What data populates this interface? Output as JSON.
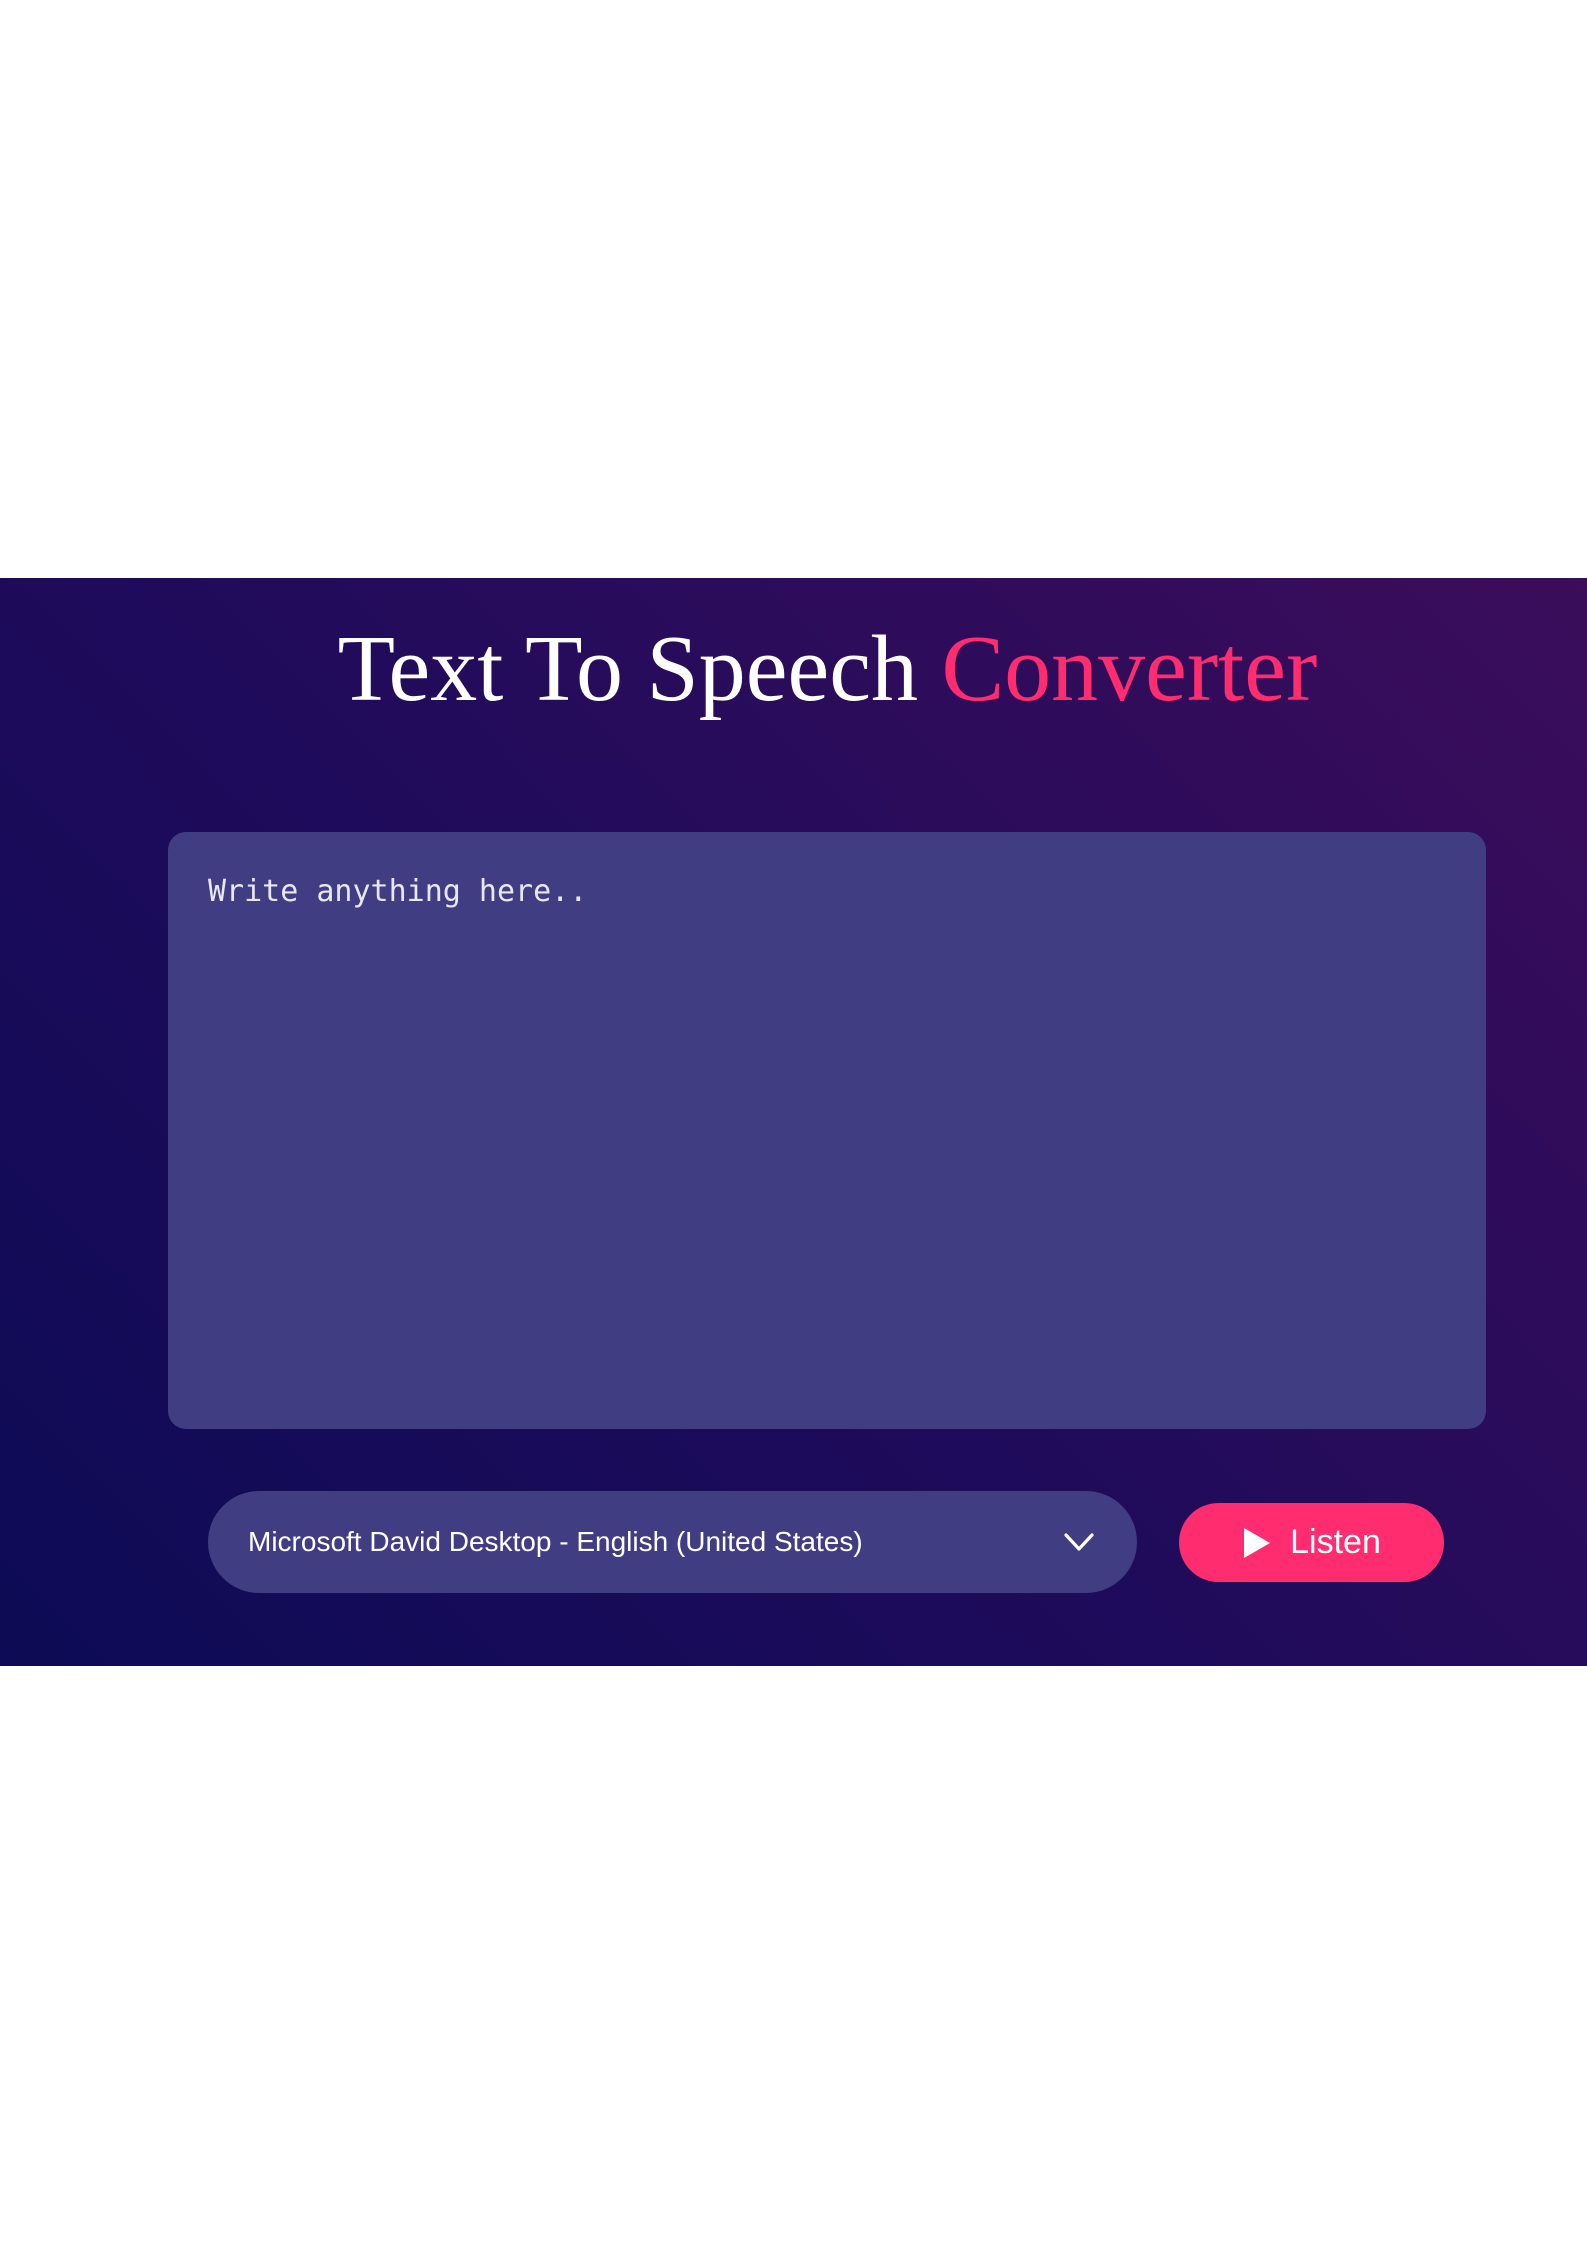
{
  "header": {
    "title_main": "Text To Speech",
    "title_accent": "Converter"
  },
  "editor": {
    "placeholder": "Write anything here..",
    "value": ""
  },
  "voice": {
    "selected": "Microsoft David Desktop - English (United States)"
  },
  "actions": {
    "listen_label": "Listen"
  },
  "icons": {
    "dropdown": "chevron-down-icon",
    "listen": "play-icon"
  },
  "colors": {
    "accent": "#ff2d6f",
    "panel": "#413d82",
    "background_start": "#0d0b55",
    "background_end": "#3b0d5b",
    "text": "#ffffff"
  }
}
